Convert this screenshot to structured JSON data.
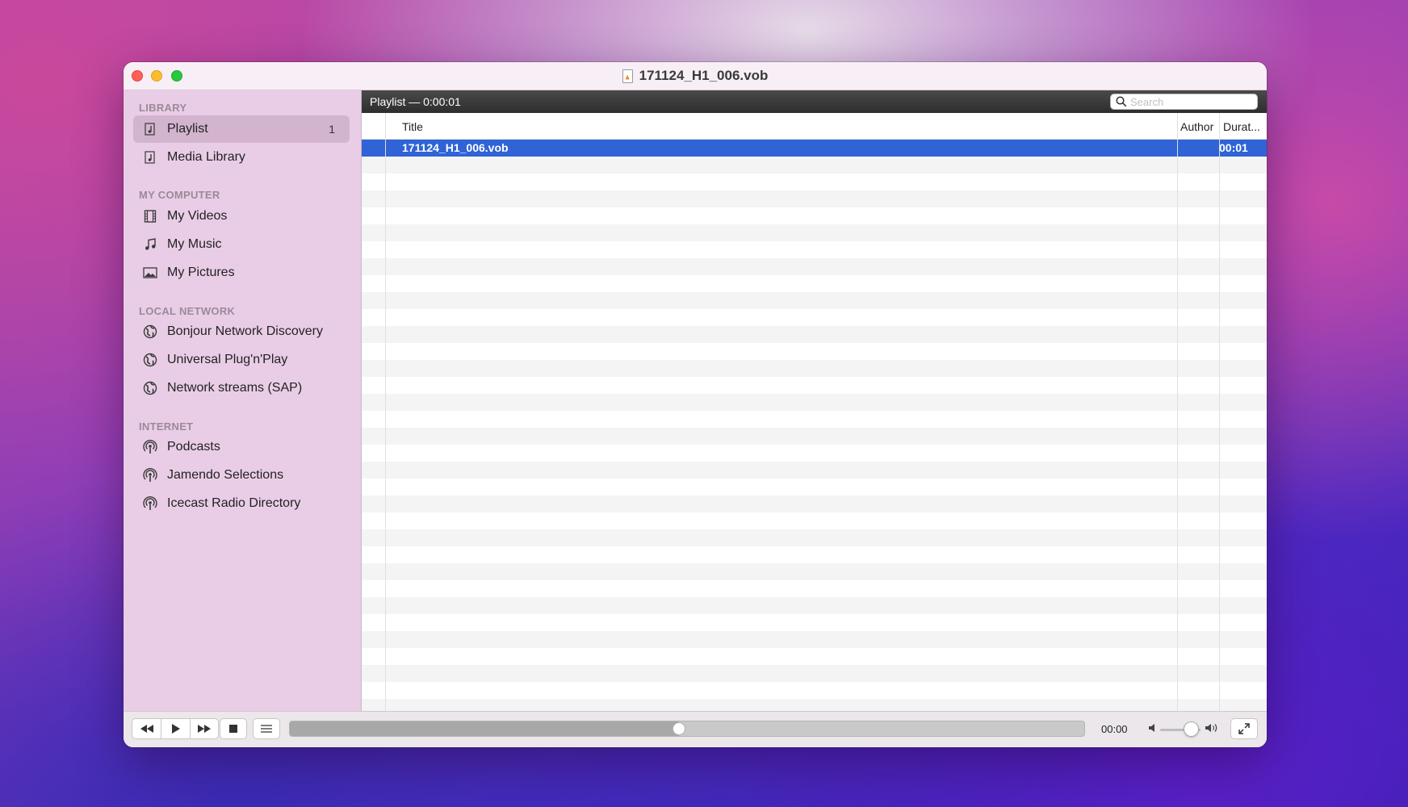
{
  "window": {
    "title": "171124_H1_006.vob"
  },
  "sidebar": {
    "sections": [
      {
        "header": "LIBRARY",
        "items": [
          {
            "label": "Playlist",
            "icon": "playlist-icon",
            "badge": "1",
            "selected": true
          },
          {
            "label": "Media Library",
            "icon": "playlist-icon"
          }
        ]
      },
      {
        "header": "MY COMPUTER",
        "items": [
          {
            "label": "My Videos",
            "icon": "film-icon"
          },
          {
            "label": "My Music",
            "icon": "music-note-icon"
          },
          {
            "label": "My Pictures",
            "icon": "picture-icon"
          }
        ]
      },
      {
        "header": "LOCAL NETWORK",
        "items": [
          {
            "label": "Bonjour Network Discovery",
            "icon": "network-globe-icon"
          },
          {
            "label": "Universal Plug'n'Play",
            "icon": "network-globe-icon"
          },
          {
            "label": "Network streams (SAP)",
            "icon": "network-globe-icon"
          }
        ]
      },
      {
        "header": "INTERNET",
        "items": [
          {
            "label": "Podcasts",
            "icon": "podcast-icon"
          },
          {
            "label": "Jamendo Selections",
            "icon": "podcast-icon"
          },
          {
            "label": "Icecast Radio Directory",
            "icon": "podcast-icon"
          }
        ]
      }
    ]
  },
  "playlist": {
    "header": "Playlist — 0:00:01",
    "search_placeholder": "Search",
    "columns": {
      "title": "Title",
      "author": "Author",
      "duration": "Durat..."
    },
    "rows": [
      {
        "title": "171124_H1_006.vob",
        "author": "",
        "duration": "00:01",
        "selected": true
      }
    ]
  },
  "controls": {
    "time": "00:00",
    "progress": 0.49,
    "volume": 0.75
  },
  "colors": {
    "selection": "#2f63d6",
    "sidebar_bg": "#e9cde6",
    "sidebar_selected": "#d3b4cf"
  }
}
